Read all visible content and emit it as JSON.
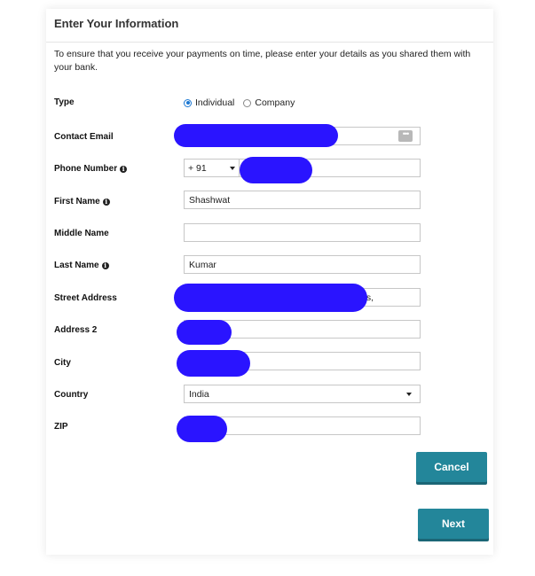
{
  "form": {
    "title": "Enter Your Information",
    "intro": "To ensure that you receive your payments on time, please enter your details as you shared them with your bank.",
    "type_label": "Type",
    "type_options": [
      "Individual",
      "Company"
    ],
    "type_selected": "Individual",
    "email_label": "Contact Email",
    "email_value": "",
    "phone_label": "Phone Number",
    "phone_code": "+ 91",
    "phone_value": "",
    "first_name_label": "First Name",
    "first_name_value": "Shashwat",
    "middle_name_label": "Middle Name",
    "middle_name_value": "",
    "last_name_label": "Last Name",
    "last_name_value": "Kumar",
    "street_label": "Street Address",
    "street_value_visible_tail": "s,",
    "address2_label": "Address 2",
    "address2_value": "",
    "city_label": "City",
    "city_value": "",
    "country_label": "Country",
    "country_value": "India",
    "zip_label": "ZIP",
    "zip_value": ""
  },
  "buttons": {
    "cancel": "Cancel",
    "next": "Next"
  },
  "icons": {
    "info": "info-icon",
    "dropdown": "chevron-down-icon",
    "autofill": "more-dots-icon"
  },
  "colors": {
    "accent": "#23869a",
    "radio": "#1976d2",
    "redaction": "#2a14ff"
  }
}
